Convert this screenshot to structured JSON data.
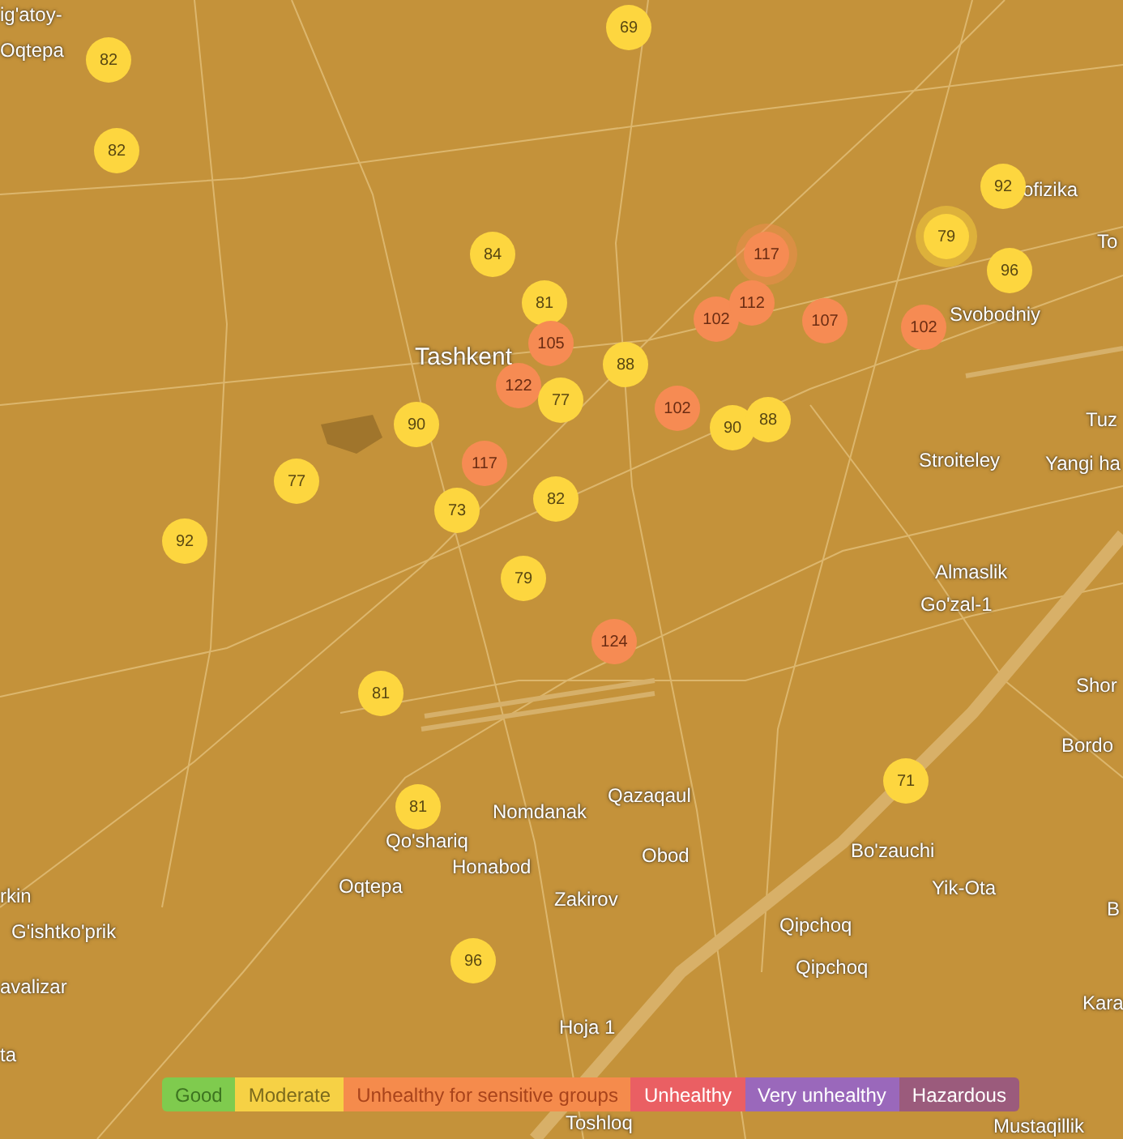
{
  "map": {
    "place_labels": [
      "ig'atoy-",
      "Oqtepa",
      "ofizika",
      "To",
      "Tashkent",
      "Svobodniy",
      "Tuz",
      "Stroiteley",
      "Yangi ha",
      "Almaslik",
      "Go'zal-1",
      "Shor",
      "Bordo",
      "Qazaqaul",
      "Nomdanak",
      "Qo'shariq",
      "Honabod",
      "Obod",
      "Bo'zauchi",
      "rkin",
      "Oqtepa",
      "Zakirov",
      "Yik-Ota",
      "B",
      "G'ishtko'prik",
      "Qipchoq",
      "Qipchoq",
      "avalizar",
      "Kara",
      "Hoja 1",
      "ta",
      "Toshloq",
      "Mustaqillik"
    ],
    "markers": [
      {
        "value": "82",
        "kind": "moderate",
        "highlighted": false
      },
      {
        "value": "69",
        "kind": "moderate",
        "highlighted": false
      },
      {
        "value": "82",
        "kind": "moderate",
        "highlighted": false
      },
      {
        "value": "92",
        "kind": "moderate",
        "highlighted": false
      },
      {
        "value": "79",
        "kind": "moderate",
        "highlighted": true
      },
      {
        "value": "117",
        "kind": "sensitive",
        "highlighted": true
      },
      {
        "value": "96",
        "kind": "moderate",
        "highlighted": false
      },
      {
        "value": "84",
        "kind": "moderate",
        "highlighted": false
      },
      {
        "value": "81",
        "kind": "moderate",
        "highlighted": false
      },
      {
        "value": "102",
        "kind": "sensitive",
        "highlighted": false
      },
      {
        "value": "112",
        "kind": "sensitive",
        "highlighted": false
      },
      {
        "value": "107",
        "kind": "sensitive",
        "highlighted": false
      },
      {
        "value": "102",
        "kind": "sensitive",
        "highlighted": false
      },
      {
        "value": "105",
        "kind": "sensitive",
        "highlighted": false
      },
      {
        "value": "88",
        "kind": "moderate",
        "highlighted": false
      },
      {
        "value": "122",
        "kind": "sensitive",
        "highlighted": false
      },
      {
        "value": "77",
        "kind": "moderate",
        "highlighted": false
      },
      {
        "value": "102",
        "kind": "sensitive",
        "highlighted": false
      },
      {
        "value": "90",
        "kind": "moderate",
        "highlighted": false
      },
      {
        "value": "90",
        "kind": "moderate",
        "highlighted": false
      },
      {
        "value": "88",
        "kind": "moderate",
        "highlighted": false
      },
      {
        "value": "117",
        "kind": "sensitive",
        "highlighted": false
      },
      {
        "value": "77",
        "kind": "moderate",
        "highlighted": false
      },
      {
        "value": "73",
        "kind": "moderate",
        "highlighted": false
      },
      {
        "value": "82",
        "kind": "moderate",
        "highlighted": false
      },
      {
        "value": "92",
        "kind": "moderate",
        "highlighted": false
      },
      {
        "value": "79",
        "kind": "moderate",
        "highlighted": false
      },
      {
        "value": "124",
        "kind": "sensitive",
        "highlighted": false
      },
      {
        "value": "81",
        "kind": "moderate",
        "highlighted": false
      },
      {
        "value": "71",
        "kind": "moderate",
        "highlighted": false
      },
      {
        "value": "81",
        "kind": "moderate",
        "highlighted": false
      },
      {
        "value": "96",
        "kind": "moderate",
        "highlighted": false
      }
    ]
  },
  "legend": [
    {
      "label": "Good",
      "color": "#7fcb4e"
    },
    {
      "label": "Moderate",
      "color": "#f6d145"
    },
    {
      "label": "Unhealthy for sensitive groups",
      "color": "#f58b4c"
    },
    {
      "label": "Unhealthy",
      "color": "#ea5f63"
    },
    {
      "label": "Very unhealthy",
      "color": "#9a68bb"
    },
    {
      "label": "Hazardous",
      "color": "#9b5b7c"
    }
  ]
}
